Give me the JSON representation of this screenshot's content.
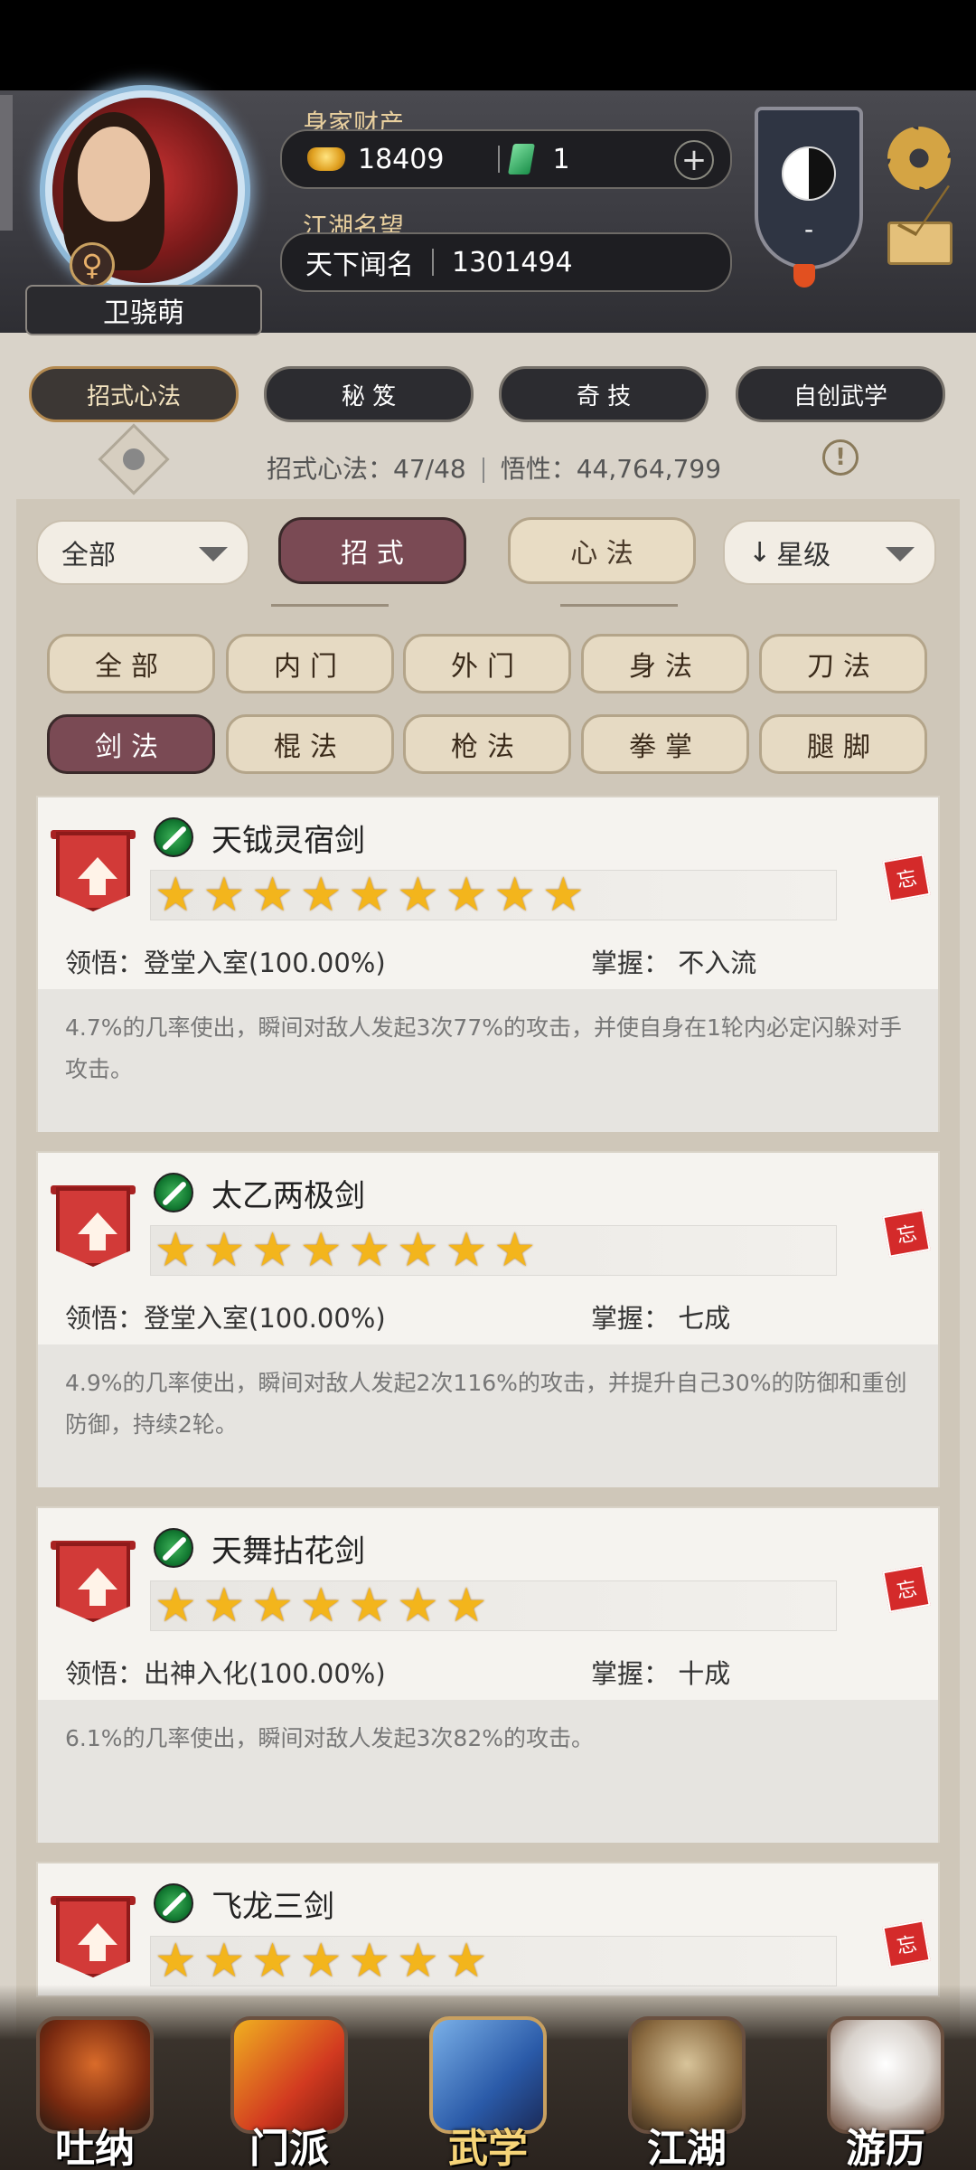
{
  "header": {
    "wealth_label": "身家财产",
    "gold": "18409",
    "jade": "1",
    "plus": "+",
    "fame_label": "江湖名望",
    "fame_title": "天下闻名",
    "fame_value": "1301494",
    "character_name": "卫骁萌",
    "gender_symbol": "♀",
    "sect_value": "-"
  },
  "top_tabs": [
    "招式心法",
    "秘 笈",
    "奇 技",
    "自创武学"
  ],
  "info": {
    "count_label": "招式心法：47/48",
    "insight_label": "悟性：44,764,799",
    "warn": "!"
  },
  "filters": {
    "scope": "全部",
    "seg_active": "招 式",
    "seg_inactive": "心 法",
    "sort": "星级",
    "sort_arrow": "↓"
  },
  "chips_row1": [
    "全部",
    "内门",
    "外门",
    "身法",
    "刀法"
  ],
  "chips_row2": [
    "剑法",
    "棍法",
    "枪法",
    "拳掌",
    "腿脚"
  ],
  "skills": [
    {
      "name": "天钺灵宿剑",
      "stars": 9,
      "comprehension": "领悟：登堂入室(100.00%)",
      "mastery": "掌握：  不入流",
      "description": "4.7%的几率使出，瞬间对敌人发起3次77%的攻击，并使自身在1轮内必定闪躲对手攻击。",
      "forget": "忘"
    },
    {
      "name": "太乙两极剑",
      "stars": 8,
      "comprehension": "领悟：登堂入室(100.00%)",
      "mastery": "掌握：  七成",
      "description": "4.9%的几率使出，瞬间对敌人发起2次116%的攻击，并提升自己30%的防御和重创防御，持续2轮。",
      "forget": "忘"
    },
    {
      "name": "天舞拈花剑",
      "stars": 7,
      "comprehension": "领悟：出神入化(100.00%)",
      "mastery": "掌握：  十成",
      "description": "6.1%的几率使出，瞬间对敌人发起3次82%的攻击。",
      "forget": "忘"
    },
    {
      "name": "飞龙三剑",
      "stars": 7,
      "comprehension": "",
      "mastery": "",
      "description": "",
      "forget": "忘"
    }
  ],
  "bottom_nav": [
    "吐纳",
    "门派",
    "武学",
    "江湖",
    "游历"
  ],
  "colors": {
    "accent_active": "#7a4a54",
    "star": "#f3b51c",
    "gold_label": "#e8cf9e"
  }
}
